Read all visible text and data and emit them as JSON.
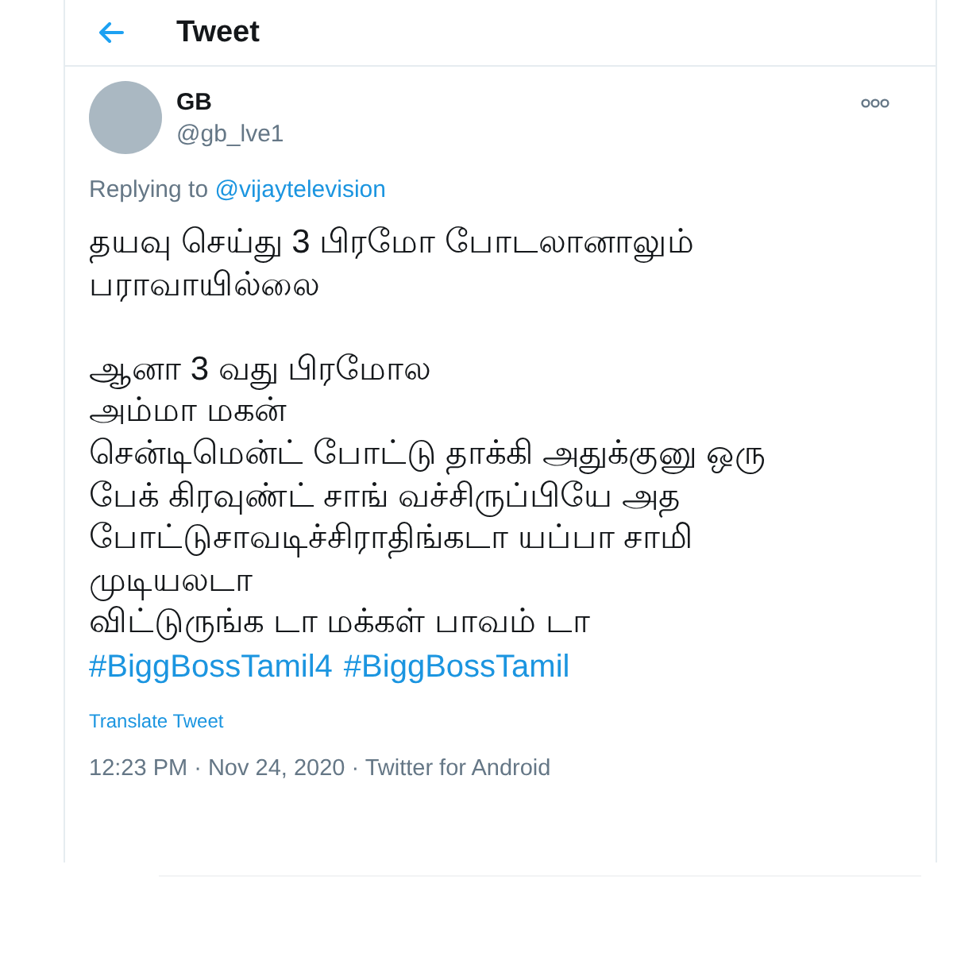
{
  "header": {
    "title": "Tweet"
  },
  "tweet": {
    "author": {
      "name": "GB",
      "handle": "@gb_lve1"
    },
    "replying_to": {
      "label": "Replying to",
      "mention": "@vijaytelevision"
    },
    "text": "தயவு செய்து 3 பிரமோ போடலானாலும்\nபராவாயில்லை\n\nஆனா 3 வது பிரமோல\nஅம்மா மகன்\nசென்டிமென்ட் போட்டு தாக்கி அதுக்குனு ஒரு\nபேக் கிரவுண்ட் சாங் வச்சிருப்பியே அத\nபோட்டுசாவடிச்சிராதிங்கடா யப்பா சாமி\nமுடியலடா\nவிட்டுருங்க டா மக்கள் பாவம் டா",
    "hashtags": [
      "#BiggBossTamil4",
      "#BiggBossTamil"
    ],
    "translate_link": "Translate Tweet",
    "meta": "12:23 PM · Nov 24, 2020 · Twitter for Android"
  }
}
